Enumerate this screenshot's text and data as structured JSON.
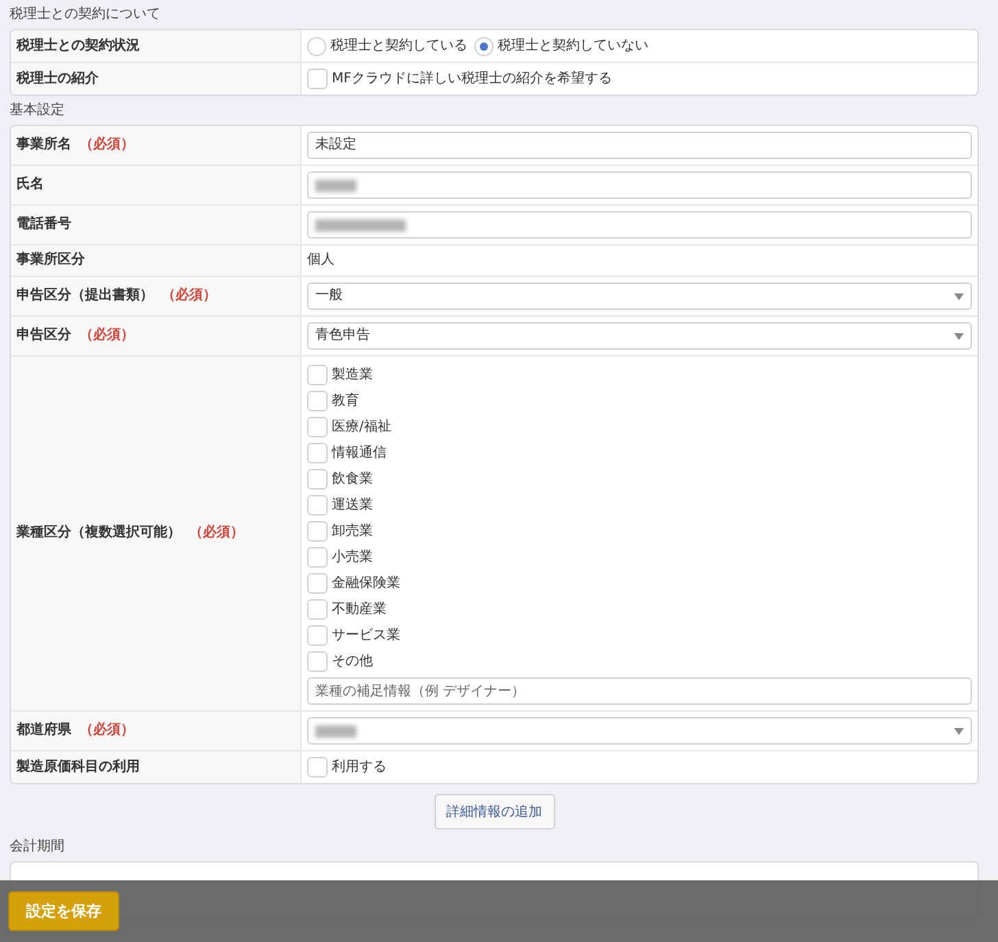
{
  "sections": [
    {
      "title": "税理士との契約について",
      "rows": [
        {
          "label": "税理士との契約状況",
          "kind": "radios",
          "options": [
            {
              "label": "税理士と契約している",
              "selected": false
            },
            {
              "label": "税理士と契約していない",
              "selected": true
            }
          ]
        },
        {
          "label": "税理士の紹介",
          "kind": "checkbox",
          "option": {
            "label": "MFクラウドに詳しい税理士の紹介を希望する",
            "checked": false
          }
        }
      ]
    },
    {
      "title": "基本設定",
      "rows": [
        {
          "label": "事業所名",
          "required": "（必須）",
          "kind": "text",
          "value": "未設定"
        },
        {
          "label": "氏名",
          "kind": "redacted"
        },
        {
          "label": "電話番号",
          "kind": "redacted"
        },
        {
          "label": "事業所区分",
          "kind": "static",
          "value": "個人"
        },
        {
          "label": "申告区分（提出書類）",
          "required": "（必須）",
          "kind": "select",
          "value": "一般"
        },
        {
          "label": "申告区分",
          "required": "（必須）",
          "kind": "select",
          "value": "青色申告"
        },
        {
          "label": "業種区分（複数選択可能）",
          "required": "（必須）",
          "kind": "checkboxes",
          "options": [
            {
              "label": "製造業",
              "checked": false
            },
            {
              "label": "教育",
              "checked": false
            },
            {
              "label": "医療/福祉",
              "checked": false
            },
            {
              "label": "情報通信",
              "checked": false
            },
            {
              "label": "飲食業",
              "checked": false
            },
            {
              "label": "運送業",
              "checked": false
            },
            {
              "label": "卸売業",
              "checked": false
            },
            {
              "label": "小売業",
              "checked": false
            },
            {
              "label": "金融保険業",
              "checked": false
            },
            {
              "label": "不動産業",
              "checked": false
            },
            {
              "label": "サービス業",
              "checked": false
            },
            {
              "label": "その他",
              "checked": false
            }
          ],
          "placeholder": "業種の補足情報（例 デザイナー）"
        },
        {
          "label": "都道府県",
          "required": "（必須）",
          "kind": "select-redacted"
        },
        {
          "label": "製造原価科目の利用",
          "kind": "checkbox",
          "option": {
            "label": "利用する",
            "checked": false
          }
        }
      ],
      "footer_button": "詳細情報の追加"
    },
    {
      "title": "会計期間"
    }
  ],
  "save_button": "設定を保存"
}
